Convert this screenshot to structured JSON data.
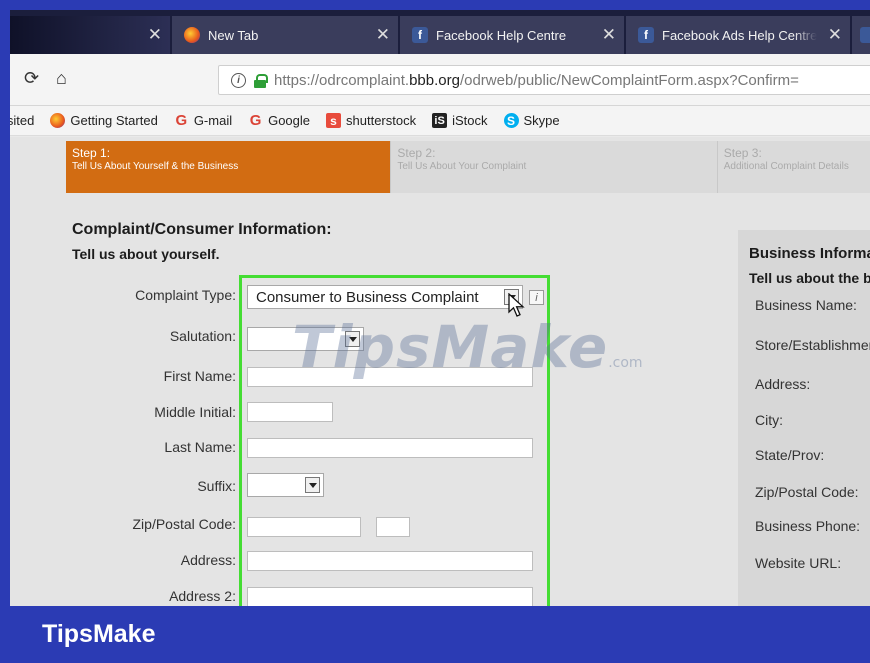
{
  "tabs": [
    {
      "label": "",
      "icon": "none"
    },
    {
      "label": "New Tab",
      "icon": "firefox-icon"
    },
    {
      "label": "Facebook Help Centre",
      "icon": "facebook-icon"
    },
    {
      "label": "Facebook Ads Help Centre",
      "icon": "facebook-icon"
    }
  ],
  "urlbar": {
    "prefix": "https://odrcomplaint.",
    "domain": "bbb.org",
    "path": "/odrweb/public/NewComplaintForm.aspx?Confirm="
  },
  "bookmarks": [
    {
      "label": "isited",
      "icon": "none"
    },
    {
      "label": "Getting Started",
      "icon": "firefox-icon"
    },
    {
      "label": "G-mail",
      "icon": "google-icon"
    },
    {
      "label": "Google",
      "icon": "google-icon"
    },
    {
      "label": "shutterstock",
      "icon": "shutterstock-icon"
    },
    {
      "label": "iStock",
      "icon": "istock-icon"
    },
    {
      "label": "Skype",
      "icon": "skype-icon"
    }
  ],
  "steps": [
    {
      "num": "Step 1:",
      "desc": "Tell Us About Yourself & the Business"
    },
    {
      "num": "Step 2:",
      "desc": "Tell Us About Your Complaint"
    },
    {
      "num": "Step 3:",
      "desc": "Additional Complaint Details"
    }
  ],
  "form": {
    "title": "Complaint/Consumer Information:",
    "subtitle": "Tell us about yourself.",
    "labels": {
      "complaint_type": "Complaint Type:",
      "salutation": "Salutation:",
      "first_name": "First Name:",
      "middle_initial": "Middle Initial:",
      "last_name": "Last Name:",
      "suffix": "Suffix:",
      "zip": "Zip/Postal Code:",
      "address": "Address:",
      "address2": "Address 2:"
    },
    "complaint_type_value": "Consumer to Business Complaint"
  },
  "business": {
    "title": "Business Information:",
    "subtitle": "Tell us about the business.",
    "labels": [
      "Business Name:",
      "Store/Establishment:",
      "Address:",
      "City:",
      "State/Prov:",
      "Zip/Postal Code:",
      "Business Phone:",
      "Website URL:"
    ]
  },
  "watermark": {
    "text": "TipsMake",
    "suffix": ".com"
  },
  "brand": "TipsMake",
  "colors": {
    "step_active": "#d26c12",
    "highlight": "#44dd33",
    "brand_bar": "#2b3bb4"
  }
}
